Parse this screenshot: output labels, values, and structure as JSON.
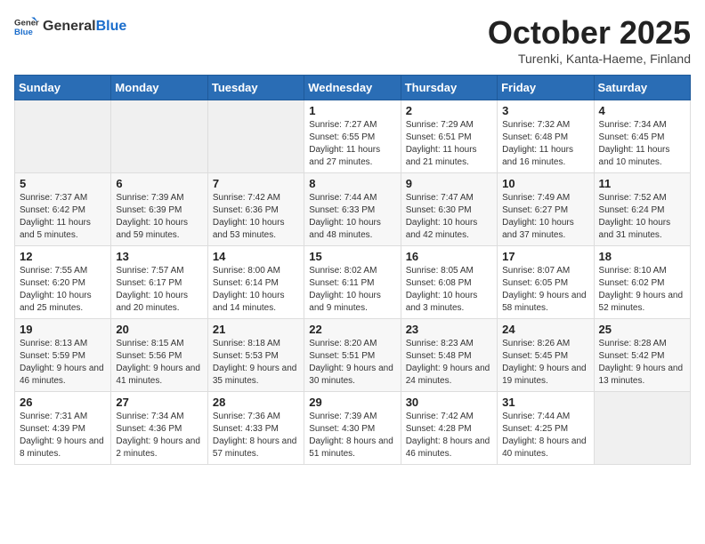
{
  "header": {
    "logo_general": "General",
    "logo_blue": "Blue",
    "month_title": "October 2025",
    "location": "Turenki, Kanta-Haeme, Finland"
  },
  "weekdays": [
    "Sunday",
    "Monday",
    "Tuesday",
    "Wednesday",
    "Thursday",
    "Friday",
    "Saturday"
  ],
  "weeks": [
    [
      {
        "day": "",
        "sunrise": "",
        "sunset": "",
        "daylight": ""
      },
      {
        "day": "",
        "sunrise": "",
        "sunset": "",
        "daylight": ""
      },
      {
        "day": "",
        "sunrise": "",
        "sunset": "",
        "daylight": ""
      },
      {
        "day": "1",
        "sunrise": "Sunrise: 7:27 AM",
        "sunset": "Sunset: 6:55 PM",
        "daylight": "Daylight: 11 hours and 27 minutes."
      },
      {
        "day": "2",
        "sunrise": "Sunrise: 7:29 AM",
        "sunset": "Sunset: 6:51 PM",
        "daylight": "Daylight: 11 hours and 21 minutes."
      },
      {
        "day": "3",
        "sunrise": "Sunrise: 7:32 AM",
        "sunset": "Sunset: 6:48 PM",
        "daylight": "Daylight: 11 hours and 16 minutes."
      },
      {
        "day": "4",
        "sunrise": "Sunrise: 7:34 AM",
        "sunset": "Sunset: 6:45 PM",
        "daylight": "Daylight: 11 hours and 10 minutes."
      }
    ],
    [
      {
        "day": "5",
        "sunrise": "Sunrise: 7:37 AM",
        "sunset": "Sunset: 6:42 PM",
        "daylight": "Daylight: 11 hours and 5 minutes."
      },
      {
        "day": "6",
        "sunrise": "Sunrise: 7:39 AM",
        "sunset": "Sunset: 6:39 PM",
        "daylight": "Daylight: 10 hours and 59 minutes."
      },
      {
        "day": "7",
        "sunrise": "Sunrise: 7:42 AM",
        "sunset": "Sunset: 6:36 PM",
        "daylight": "Daylight: 10 hours and 53 minutes."
      },
      {
        "day": "8",
        "sunrise": "Sunrise: 7:44 AM",
        "sunset": "Sunset: 6:33 PM",
        "daylight": "Daylight: 10 hours and 48 minutes."
      },
      {
        "day": "9",
        "sunrise": "Sunrise: 7:47 AM",
        "sunset": "Sunset: 6:30 PM",
        "daylight": "Daylight: 10 hours and 42 minutes."
      },
      {
        "day": "10",
        "sunrise": "Sunrise: 7:49 AM",
        "sunset": "Sunset: 6:27 PM",
        "daylight": "Daylight: 10 hours and 37 minutes."
      },
      {
        "day": "11",
        "sunrise": "Sunrise: 7:52 AM",
        "sunset": "Sunset: 6:24 PM",
        "daylight": "Daylight: 10 hours and 31 minutes."
      }
    ],
    [
      {
        "day": "12",
        "sunrise": "Sunrise: 7:55 AM",
        "sunset": "Sunset: 6:20 PM",
        "daylight": "Daylight: 10 hours and 25 minutes."
      },
      {
        "day": "13",
        "sunrise": "Sunrise: 7:57 AM",
        "sunset": "Sunset: 6:17 PM",
        "daylight": "Daylight: 10 hours and 20 minutes."
      },
      {
        "day": "14",
        "sunrise": "Sunrise: 8:00 AM",
        "sunset": "Sunset: 6:14 PM",
        "daylight": "Daylight: 10 hours and 14 minutes."
      },
      {
        "day": "15",
        "sunrise": "Sunrise: 8:02 AM",
        "sunset": "Sunset: 6:11 PM",
        "daylight": "Daylight: 10 hours and 9 minutes."
      },
      {
        "day": "16",
        "sunrise": "Sunrise: 8:05 AM",
        "sunset": "Sunset: 6:08 PM",
        "daylight": "Daylight: 10 hours and 3 minutes."
      },
      {
        "day": "17",
        "sunrise": "Sunrise: 8:07 AM",
        "sunset": "Sunset: 6:05 PM",
        "daylight": "Daylight: 9 hours and 58 minutes."
      },
      {
        "day": "18",
        "sunrise": "Sunrise: 8:10 AM",
        "sunset": "Sunset: 6:02 PM",
        "daylight": "Daylight: 9 hours and 52 minutes."
      }
    ],
    [
      {
        "day": "19",
        "sunrise": "Sunrise: 8:13 AM",
        "sunset": "Sunset: 5:59 PM",
        "daylight": "Daylight: 9 hours and 46 minutes."
      },
      {
        "day": "20",
        "sunrise": "Sunrise: 8:15 AM",
        "sunset": "Sunset: 5:56 PM",
        "daylight": "Daylight: 9 hours and 41 minutes."
      },
      {
        "day": "21",
        "sunrise": "Sunrise: 8:18 AM",
        "sunset": "Sunset: 5:53 PM",
        "daylight": "Daylight: 9 hours and 35 minutes."
      },
      {
        "day": "22",
        "sunrise": "Sunrise: 8:20 AM",
        "sunset": "Sunset: 5:51 PM",
        "daylight": "Daylight: 9 hours and 30 minutes."
      },
      {
        "day": "23",
        "sunrise": "Sunrise: 8:23 AM",
        "sunset": "Sunset: 5:48 PM",
        "daylight": "Daylight: 9 hours and 24 minutes."
      },
      {
        "day": "24",
        "sunrise": "Sunrise: 8:26 AM",
        "sunset": "Sunset: 5:45 PM",
        "daylight": "Daylight: 9 hours and 19 minutes."
      },
      {
        "day": "25",
        "sunrise": "Sunrise: 8:28 AM",
        "sunset": "Sunset: 5:42 PM",
        "daylight": "Daylight: 9 hours and 13 minutes."
      }
    ],
    [
      {
        "day": "26",
        "sunrise": "Sunrise: 7:31 AM",
        "sunset": "Sunset: 4:39 PM",
        "daylight": "Daylight: 9 hours and 8 minutes."
      },
      {
        "day": "27",
        "sunrise": "Sunrise: 7:34 AM",
        "sunset": "Sunset: 4:36 PM",
        "daylight": "Daylight: 9 hours and 2 minutes."
      },
      {
        "day": "28",
        "sunrise": "Sunrise: 7:36 AM",
        "sunset": "Sunset: 4:33 PM",
        "daylight": "Daylight: 8 hours and 57 minutes."
      },
      {
        "day": "29",
        "sunrise": "Sunrise: 7:39 AM",
        "sunset": "Sunset: 4:30 PM",
        "daylight": "Daylight: 8 hours and 51 minutes."
      },
      {
        "day": "30",
        "sunrise": "Sunrise: 7:42 AM",
        "sunset": "Sunset: 4:28 PM",
        "daylight": "Daylight: 8 hours and 46 minutes."
      },
      {
        "day": "31",
        "sunrise": "Sunrise: 7:44 AM",
        "sunset": "Sunset: 4:25 PM",
        "daylight": "Daylight: 8 hours and 40 minutes."
      },
      {
        "day": "",
        "sunrise": "",
        "sunset": "",
        "daylight": ""
      }
    ]
  ]
}
